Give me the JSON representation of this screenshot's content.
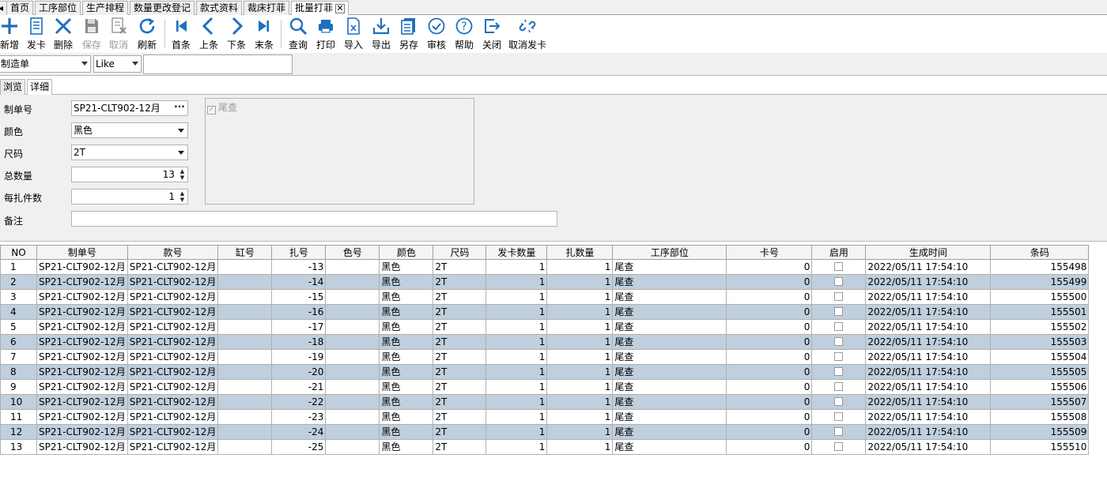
{
  "window_tabs": [
    {
      "label": "首页",
      "active": false
    },
    {
      "label": "工序部位",
      "active": false
    },
    {
      "label": "生产排程",
      "active": false
    },
    {
      "label": "数量更改登记",
      "active": false
    },
    {
      "label": "款式资料",
      "active": false
    },
    {
      "label": "裁床打菲",
      "active": false
    },
    {
      "label": "批量打菲",
      "active": true
    }
  ],
  "toolbar": {
    "new": "新增",
    "issue_card": "发卡",
    "delete": "删除",
    "save": "保存",
    "cancel": "取消",
    "refresh": "刷新",
    "first": "首条",
    "prev": "上条",
    "next": "下条",
    "last": "末条",
    "query": "查询",
    "print": "打印",
    "import": "导入",
    "export": "导出",
    "save_as": "另存",
    "audit": "审核",
    "help": "帮助",
    "close": "关闭",
    "cancel_issue": "取消发卡"
  },
  "filter": {
    "field": "制造单",
    "operator": "Like",
    "value": ""
  },
  "sub_tabs": {
    "browse": "浏览",
    "detail": "详细"
  },
  "form": {
    "order_no_label": "制单号",
    "order_no": "SP21-CLT902-12月",
    "color_label": "颜色",
    "color": "黑色",
    "size_label": "尺码",
    "size": "2T",
    "total_label": "总数量",
    "total": "13",
    "per_bundle_label": "每扎件数",
    "per_bundle": "1",
    "remark_label": "备注",
    "remark": "",
    "tail_check_label": "尾查"
  },
  "grid": {
    "headers": [
      "NO",
      "制单号",
      "款号",
      "缸号",
      "扎号",
      "色号",
      "颜色",
      "尺码",
      "发卡数量",
      "扎数量",
      "工序部位",
      "卡号",
      "启用",
      "生成时间",
      "条码"
    ],
    "rows": [
      [
        "1",
        "SP21-CLT902-12月",
        "SP21-CLT902-12月",
        "",
        "-13",
        "",
        "黑色",
        "2T",
        "1",
        "1",
        "尾查",
        "0",
        "",
        "2022/05/11 17:54:10",
        "155498"
      ],
      [
        "2",
        "SP21-CLT902-12月",
        "SP21-CLT902-12月",
        "",
        "-14",
        "",
        "黑色",
        "2T",
        "1",
        "1",
        "尾查",
        "0",
        "",
        "2022/05/11 17:54:10",
        "155499"
      ],
      [
        "3",
        "SP21-CLT902-12月",
        "SP21-CLT902-12月",
        "",
        "-15",
        "",
        "黑色",
        "2T",
        "1",
        "1",
        "尾查",
        "0",
        "",
        "2022/05/11 17:54:10",
        "155500"
      ],
      [
        "4",
        "SP21-CLT902-12月",
        "SP21-CLT902-12月",
        "",
        "-16",
        "",
        "黑色",
        "2T",
        "1",
        "1",
        "尾查",
        "0",
        "",
        "2022/05/11 17:54:10",
        "155501"
      ],
      [
        "5",
        "SP21-CLT902-12月",
        "SP21-CLT902-12月",
        "",
        "-17",
        "",
        "黑色",
        "2T",
        "1",
        "1",
        "尾查",
        "0",
        "",
        "2022/05/11 17:54:10",
        "155502"
      ],
      [
        "6",
        "SP21-CLT902-12月",
        "SP21-CLT902-12月",
        "",
        "-18",
        "",
        "黑色",
        "2T",
        "1",
        "1",
        "尾查",
        "0",
        "",
        "2022/05/11 17:54:10",
        "155503"
      ],
      [
        "7",
        "SP21-CLT902-12月",
        "SP21-CLT902-12月",
        "",
        "-19",
        "",
        "黑色",
        "2T",
        "1",
        "1",
        "尾查",
        "0",
        "",
        "2022/05/11 17:54:10",
        "155504"
      ],
      [
        "8",
        "SP21-CLT902-12月",
        "SP21-CLT902-12月",
        "",
        "-20",
        "",
        "黑色",
        "2T",
        "1",
        "1",
        "尾查",
        "0",
        "",
        "2022/05/11 17:54:10",
        "155505"
      ],
      [
        "9",
        "SP21-CLT902-12月",
        "SP21-CLT902-12月",
        "",
        "-21",
        "",
        "黑色",
        "2T",
        "1",
        "1",
        "尾查",
        "0",
        "",
        "2022/05/11 17:54:10",
        "155506"
      ],
      [
        "10",
        "SP21-CLT902-12月",
        "SP21-CLT902-12月",
        "",
        "-22",
        "",
        "黑色",
        "2T",
        "1",
        "1",
        "尾查",
        "0",
        "",
        "2022/05/11 17:54:10",
        "155507"
      ],
      [
        "11",
        "SP21-CLT902-12月",
        "SP21-CLT902-12月",
        "",
        "-23",
        "",
        "黑色",
        "2T",
        "1",
        "1",
        "尾查",
        "0",
        "",
        "2022/05/11 17:54:10",
        "155508"
      ],
      [
        "12",
        "SP21-CLT902-12月",
        "SP21-CLT902-12月",
        "",
        "-24",
        "",
        "黑色",
        "2T",
        "1",
        "1",
        "尾查",
        "0",
        "",
        "2022/05/11 17:54:10",
        "155509"
      ],
      [
        "13",
        "SP21-CLT902-12月",
        "SP21-CLT902-12月",
        "",
        "-25",
        "",
        "黑色",
        "2T",
        "1",
        "1",
        "尾查",
        "0",
        "",
        "2022/05/11 17:54:10",
        "155510"
      ]
    ]
  },
  "colors": {
    "accent": "#1e6fbf",
    "row_alt": "#bfcfdd",
    "disabled": "#9a9a9a"
  }
}
